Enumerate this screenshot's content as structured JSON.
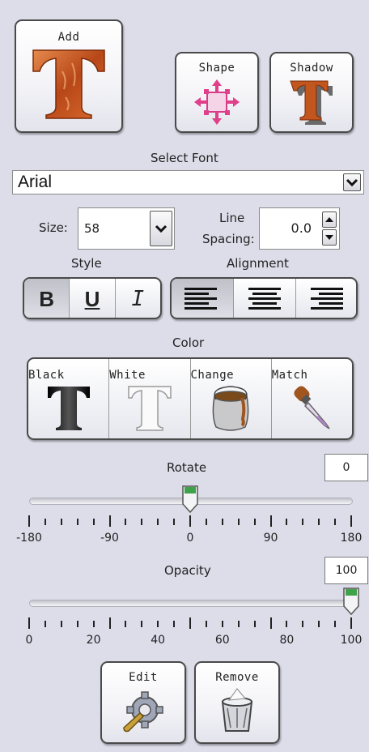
{
  "add_button": {
    "label": "Add",
    "icon": "text-t-icon"
  },
  "shape_button": {
    "label": "Shape",
    "icon": "shape-move-icon"
  },
  "shadow_button": {
    "label": "Shadow",
    "icon": "shadow-t-icon"
  },
  "font": {
    "heading": "Select Font",
    "selected": "Arial"
  },
  "size": {
    "label": "Size:",
    "value": "58"
  },
  "line_spacing": {
    "label_line1": "Line",
    "label_line2": "Spacing:",
    "value": "0.0"
  },
  "style": {
    "heading": "Style",
    "bold": "B",
    "underline": "U",
    "italic": "I",
    "pressed": "bold"
  },
  "alignment": {
    "heading": "Alignment",
    "selected": "left"
  },
  "color": {
    "heading": "Color",
    "black": "Black",
    "white": "White",
    "change": "Change",
    "match": "Match"
  },
  "rotate": {
    "label": "Rotate",
    "value": "0",
    "min": -180,
    "max": 180,
    "current": 0,
    "tick_labels": [
      "-180",
      "-90",
      "0",
      "90",
      "180"
    ]
  },
  "opacity": {
    "label": "Opacity",
    "value": "100",
    "min": 0,
    "max": 100,
    "current": 100,
    "tick_labels": [
      "0",
      "20",
      "40",
      "60",
      "80",
      "100"
    ]
  },
  "edit_button": {
    "label": "Edit",
    "icon": "gear-wrench-icon"
  },
  "remove_button": {
    "label": "Remove",
    "icon": "trash-icon"
  },
  "colors": {
    "background": "#dcdde9",
    "t_orange": "#c1561f",
    "accent_pink": "#e0408a",
    "slider_green": "#3fa24a"
  }
}
